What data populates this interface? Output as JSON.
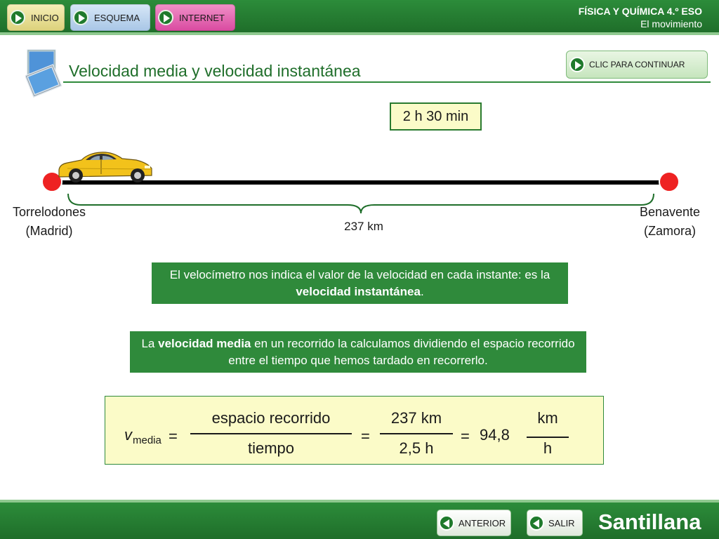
{
  "header": {
    "nav": [
      {
        "label": "INICIO"
      },
      {
        "label": "ESQUEMA"
      },
      {
        "label": "INTERNET"
      }
    ],
    "course": "FÍSICA Y QUÍMICA 4.º ESO",
    "unit": "El movimiento"
  },
  "page": {
    "title": "Velocidad media y velocidad instantánea",
    "continue_label": "CLIC PARA CONTINUAR"
  },
  "scene": {
    "time": "2 h 30 min",
    "origin_line1": "Torrelodones",
    "origin_line2": "(Madrid)",
    "destination_line1": "Benavente",
    "destination_line2": "(Zamora)",
    "distance": "237 km"
  },
  "info": {
    "instant_pre": "El velocímetro nos indica el valor de la velocidad en cada instante: es la ",
    "instant_bold": "velocidad instantánea",
    "instant_post": ".",
    "mean_pre": "La ",
    "mean_bold": "velocidad media",
    "mean_post": " en un recorrido la calculamos dividiendo el espacio recorrido entre el tiempo que hemos tardado en recorrerlo."
  },
  "formula": {
    "v": "v",
    "sub": "media",
    "eq": "=",
    "num1": "espacio recorrido",
    "den1": "tiempo",
    "num2": "237 km",
    "den2": "2,5 h",
    "result": "94,8",
    "unit_num": "km",
    "unit_den": "h"
  },
  "footer": {
    "prev_label": "ANTERIOR",
    "exit_label": "SALIR",
    "brand": "Santillana"
  },
  "colors": {
    "bar_green": "#1f6e2a",
    "accent_green": "#2f8a3b",
    "marker_red": "#ee2222",
    "highlight_yellow": "#fbfbc8",
    "car_yellow": "#f2c21b"
  }
}
